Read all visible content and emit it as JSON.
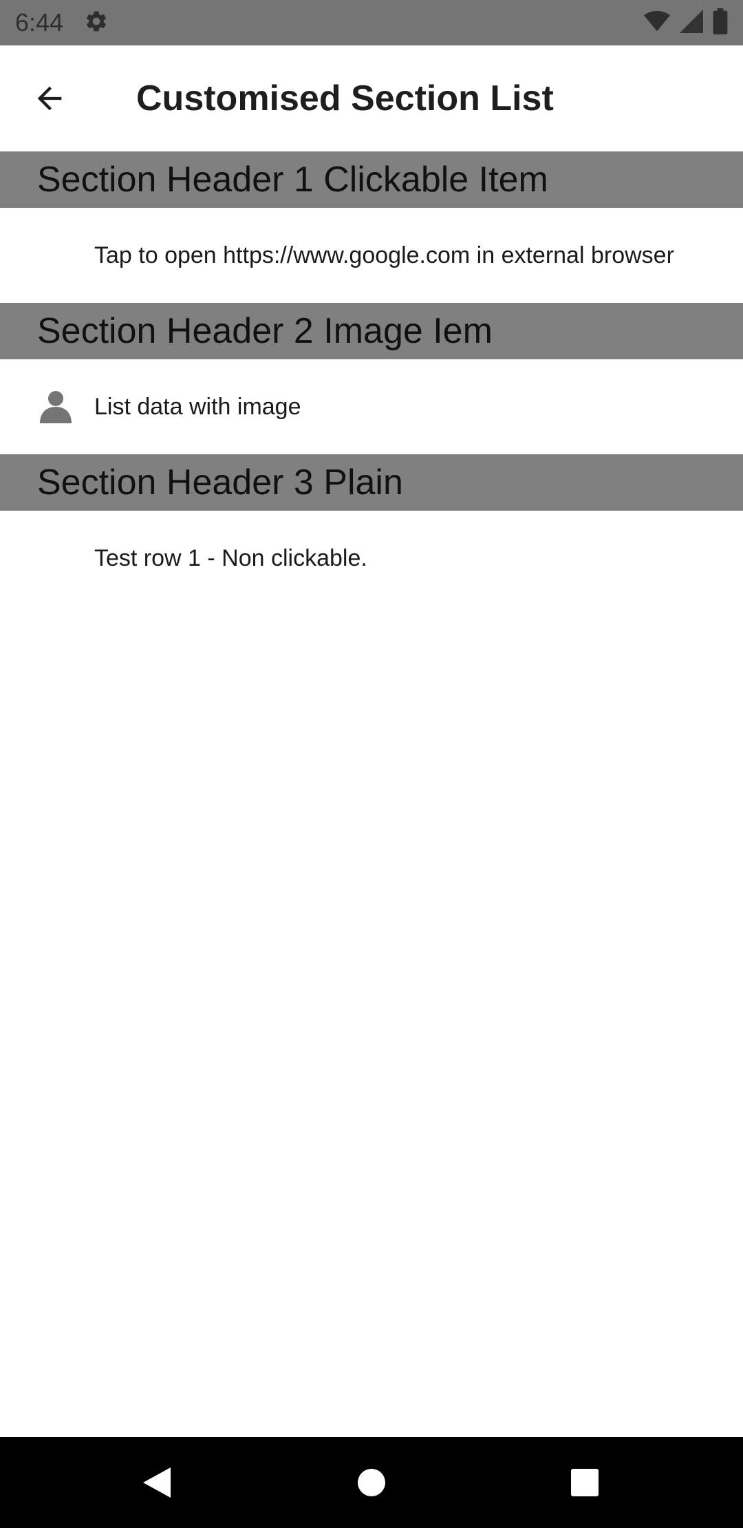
{
  "status_bar": {
    "time": "6:44",
    "icons": [
      "settings-icon",
      "wifi-icon",
      "signal-icon",
      "battery-icon"
    ]
  },
  "app_bar": {
    "title": "Customised Section List",
    "back_icon": "arrow-back-icon"
  },
  "sections": [
    {
      "header": "Section Header 1 Clickable Item",
      "rows": [
        {
          "text": "Tap to open https://www.google.com in external browser",
          "icon": null
        }
      ]
    },
    {
      "header": "Section Header 2 Image Iem",
      "rows": [
        {
          "text": "List data with image",
          "icon": "person-icon"
        }
      ]
    },
    {
      "header": "Section Header 3 Plain",
      "rows": [
        {
          "text": "Test row 1 - Non clickable.",
          "icon": null
        }
      ]
    }
  ],
  "nav_bar": {
    "icons": [
      "back-triangle-icon",
      "home-circle-icon",
      "recents-square-icon"
    ]
  },
  "colors": {
    "status_bar": "#757575",
    "section_header": "#808080",
    "nav_bar": "#000000",
    "icon_gray": "#757575"
  }
}
